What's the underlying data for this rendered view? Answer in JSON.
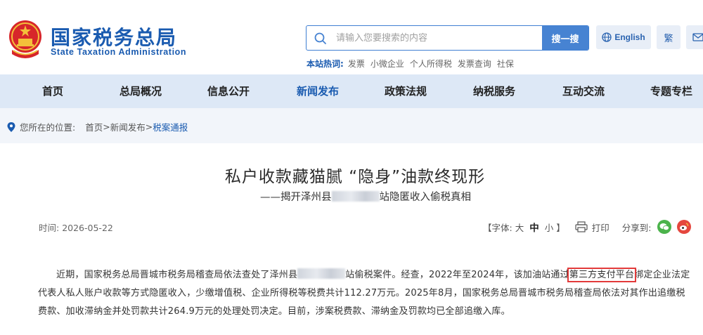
{
  "header": {
    "site_name": "国家税务总局",
    "site_name_en": "State Taxation Administration",
    "search": {
      "placeholder": "请输入您要搜索的内容",
      "button_label": "搜一搜"
    },
    "hot_label": "本站热词:",
    "hot_words": [
      "发票",
      "小微企业",
      "个人所得税",
      "发票查询",
      "社保"
    ],
    "lang_en": "English",
    "lang_tw": "繁"
  },
  "nav": {
    "items": [
      "首页",
      "总局概况",
      "信息公开",
      "新闻发布",
      "政策法规",
      "纳税服务",
      "互动交流",
      "专题专栏"
    ],
    "active": "新闻发布"
  },
  "breadcrumb": {
    "prefix": "您所在的位置:",
    "home": "首页",
    "sep1": ">",
    "section": "新闻发布",
    "sep2": ">",
    "current": "税案通报"
  },
  "article": {
    "title": "私户收款藏猫腻 “隐身”油款终现形",
    "subtitle_pre": "——揭开泽州县",
    "subtitle_post": "站隐匿收入偷税真相",
    "date_label": "时间:",
    "date": "2026-05-22",
    "font_label_open": "【字体:",
    "font_large": "大",
    "font_medium": "中",
    "font_small": "小",
    "font_label_close": "】",
    "print_label": "打印",
    "share_label": "分享到:",
    "para_1": "近期，国家税务总局晋城市税务局稽查局依法查处了泽州县",
    "para_2": "站偷税案件。经查，2022年至2024年，该加油站通过",
    "para_highlight": "第三方支付平台",
    "para_3": "绑定企业法定代表人私人账户收款等方式隐匿收入，少缴增值税、企业所得税等税费共计112.27万元。2025年8月，国家税务总局晋城市税务局稽查局依法对其作出追缴税费款、加收滞纳金并处罚款共计264.9万元的处理处罚决定。目前，涉案税费款、滞纳金及罚款均已全部追缴入库。"
  },
  "colors": {
    "brand_blue": "#1a5bb0",
    "nav_bg": "#dde8f6",
    "highlight_red": "#e23a3a"
  }
}
